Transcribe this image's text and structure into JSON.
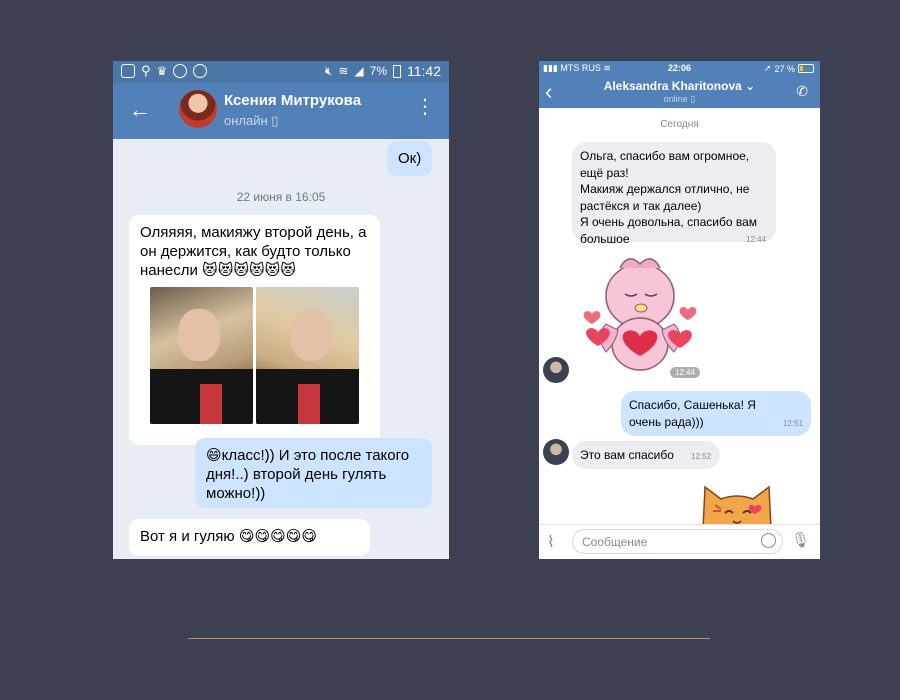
{
  "left_phone": {
    "status_time": "11:42",
    "battery": "7%",
    "contact_name": "Ксения Митрукова",
    "contact_status": "онлайн",
    "messages": {
      "out1": "Ок)",
      "date": "22 июня в 16:05",
      "in1": "Оляяяя, макияжу второй день, а он держится, как будто только нанесли 😻😻😻😻😻😻",
      "out2": "😄класс!)) И это после такого дня!..) второй день гулять можно!))",
      "in2": "Вот я и гуляю 😋😋😋😋😋"
    }
  },
  "right_phone": {
    "carrier": "MTS RUS",
    "status_time": "22:06",
    "battery": "27 %",
    "contact_name": "Aleksandra Kharitonova",
    "contact_status": "online",
    "today_label": "Сегодня",
    "messages": {
      "in1": "Ольга, спасибо вам огромное, ещё раз!\nМакияж держался отлично, не растёкся и так далее)\nЯ очень довольна, спасибо вам большое",
      "in1_time": "12:44",
      "sticker_time": "12:44",
      "out1": "Спасибо, Сашенька! Я очень рада)))",
      "out1_time": "12:51",
      "in2": "Это вам спасибо",
      "in2_time": "12:52"
    },
    "input_placeholder": "Сообщение"
  }
}
